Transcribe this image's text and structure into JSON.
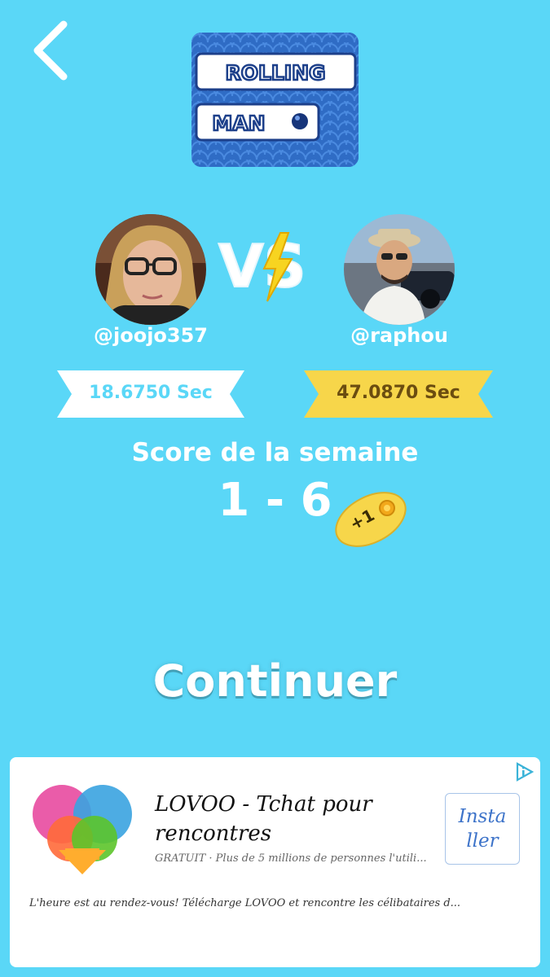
{
  "game": {
    "logo_line1": "ROLLING",
    "logo_line2": "MAN"
  },
  "players": {
    "left": {
      "username": "@joojo357",
      "time": "18.6750 Sec"
    },
    "right": {
      "username": "@raphou",
      "time": "47.0870 Sec"
    }
  },
  "versus_text": "VS",
  "week": {
    "title": "Score de la semaine",
    "score": "1 - 6",
    "reward": "+1"
  },
  "continue_label": "Continuer",
  "ad": {
    "title": "LOVOO - Tchat pour rencontres",
    "subtitle": "GRATUIT · Plus de 5 millions de personnes l'utili...",
    "install_label": "Insta ller",
    "description": "L'heure est au rendez-vous! Télécharge LOVOO et rencontre les célibataires d..."
  },
  "colors": {
    "background": "#5ad7f7",
    "ribbon_white": "#ffffff",
    "ribbon_gold": "#f7d64a",
    "accent_blue": "#3d73c9"
  },
  "icons": {
    "back": "chevron-left-icon",
    "lightning": "lightning-icon",
    "coin": "coin-icon",
    "ad_choices": "ad-choices-icon"
  }
}
